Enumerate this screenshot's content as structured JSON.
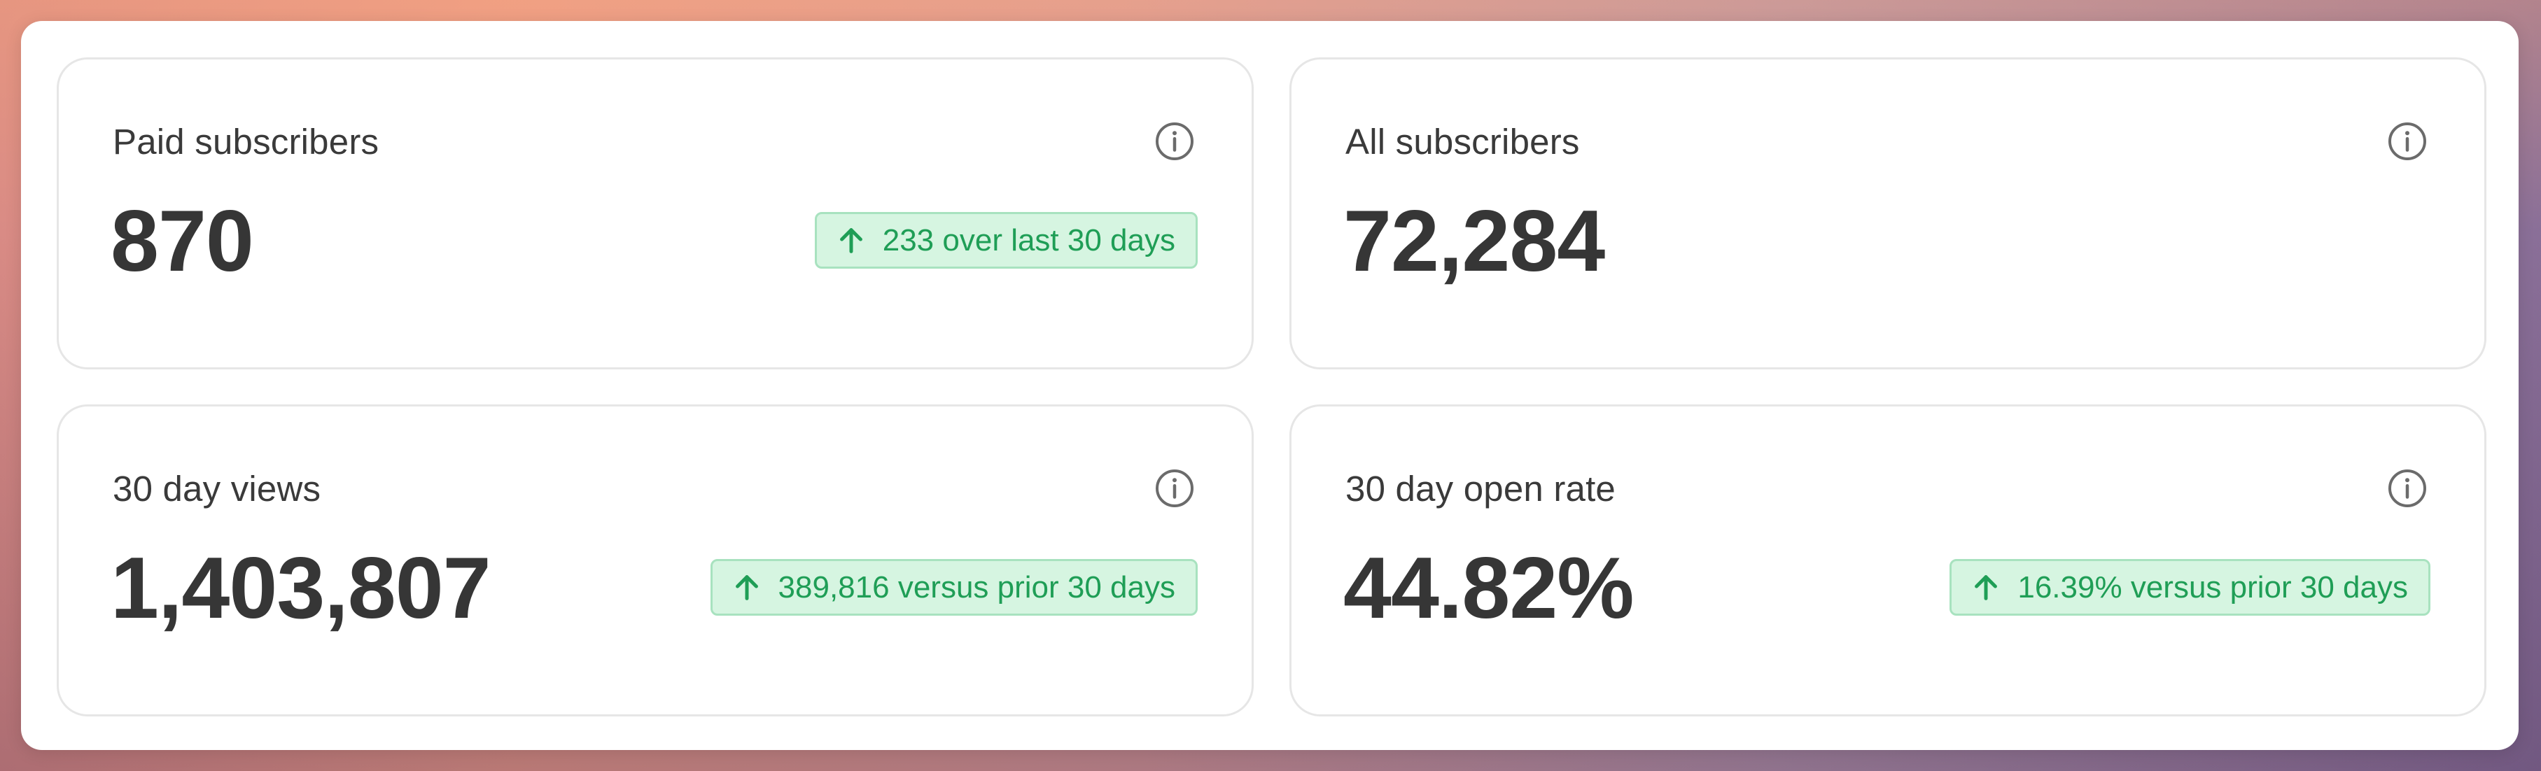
{
  "colors": {
    "accent_green": "#1f9e56",
    "badge_bg": "#d6f5e1",
    "text_primary": "#363636"
  },
  "cards": [
    {
      "title": "Paid subscribers",
      "value": "870",
      "trend": {
        "icon": "arrow-up-icon",
        "text": "233 over last 30 days"
      },
      "info_icon": "info-icon"
    },
    {
      "title": "All subscribers",
      "value": "72,284",
      "info_icon": "info-icon"
    },
    {
      "title": "30 day views",
      "value": "1,403,807",
      "trend": {
        "icon": "arrow-up-icon",
        "text": "389,816 versus prior 30 days"
      },
      "info_icon": "info-icon"
    },
    {
      "title": "30 day open rate",
      "value": "44.82%",
      "trend": {
        "icon": "arrow-up-icon",
        "text": "16.39% versus prior 30 days"
      },
      "info_icon": "info-icon"
    }
  ]
}
